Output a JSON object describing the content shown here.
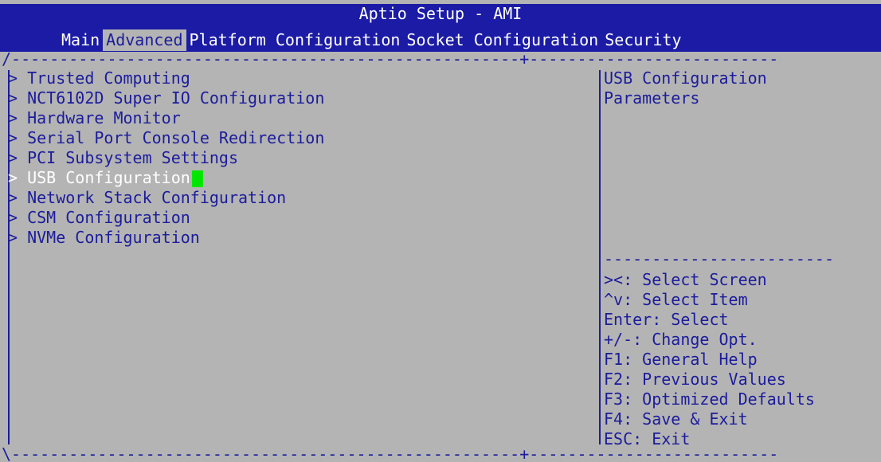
{
  "window": {
    "title": "Aptio Setup - AMI"
  },
  "tabs": [
    {
      "label": "Main"
    },
    {
      "label": "Advanced"
    },
    {
      "label": "Platform Configuration"
    },
    {
      "label": "Socket Configuration"
    },
    {
      "label": "Security"
    }
  ],
  "menu": {
    "items": [
      {
        "label": "> Trusted Computing"
      },
      {
        "label": "> NCT6102D Super IO Configuration"
      },
      {
        "label": "> Hardware Monitor"
      },
      {
        "label": "> Serial Port Console Redirection"
      },
      {
        "label": "> PCI Subsystem Settings"
      },
      {
        "label": "> USB Configuration"
      },
      {
        "label": "> Network Stack Configuration"
      },
      {
        "label": "> CSM Configuration"
      },
      {
        "label": "> NVMe Configuration"
      }
    ],
    "selected_index": 5
  },
  "help": {
    "lines": [
      "USB Configuration",
      "Parameters"
    ]
  },
  "keys": [
    {
      "text": "><: Select Screen"
    },
    {
      "text": "^v: Select Item"
    },
    {
      "text": "Enter: Select"
    },
    {
      "text": "+/-: Change Opt."
    },
    {
      "text": "F1: General Help"
    },
    {
      "text": "F2: Previous Values"
    },
    {
      "text": "F3: Optimized Defaults"
    },
    {
      "text": "F4: Save & Exit"
    },
    {
      "text": "ESC: Exit"
    }
  ],
  "colors": {
    "background": "#b4b4b4",
    "titlebar": "#1b1ba6",
    "text": "#1c1c9c",
    "selected_text": "#ffffff",
    "cursor": "#00e600"
  }
}
